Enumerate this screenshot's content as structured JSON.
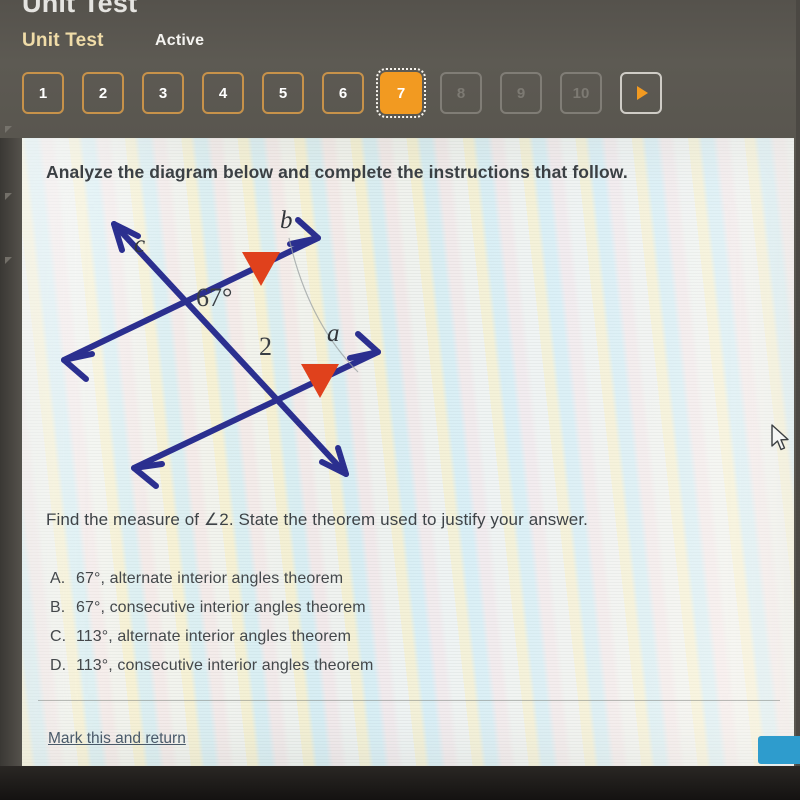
{
  "window": {
    "title_cut": "Unit Test",
    "heading": "Unit Test",
    "status": "Active",
    "header_bg": "#5a5750",
    "accent": "#f29a21"
  },
  "question_nav": {
    "buttons": [
      {
        "label": "1",
        "state": "available"
      },
      {
        "label": "2",
        "state": "available"
      },
      {
        "label": "3",
        "state": "available"
      },
      {
        "label": "4",
        "state": "available"
      },
      {
        "label": "5",
        "state": "available"
      },
      {
        "label": "6",
        "state": "available"
      },
      {
        "label": "7",
        "state": "active"
      },
      {
        "label": "8",
        "state": "disabled"
      },
      {
        "label": "9",
        "state": "disabled"
      },
      {
        "label": "10",
        "state": "disabled"
      }
    ],
    "next_label": "▶"
  },
  "content": {
    "prompt": "Analyze the diagram below and complete the instructions that follow.",
    "question_pre": "Find the measure of ",
    "question_angle": "∠2",
    "question_post": ". State the theorem used to justify your answer.",
    "choices": [
      {
        "letter": "A.",
        "text": "67°, alternate interior angles theorem"
      },
      {
        "letter": "B.",
        "text": "67°, consecutive interior angles theorem"
      },
      {
        "letter": "C.",
        "text": "113°, alternate interior angles theorem"
      },
      {
        "letter": "D.",
        "text": "113°, consecutive interior angles theorem"
      }
    ],
    "mark_link": "Mark this and return"
  },
  "diagram": {
    "line_b_label": "b",
    "line_a_label": "a",
    "line_c_label": "c",
    "angle_known": "67°",
    "angle_unknown": "2",
    "line_color": "#2b2f8f",
    "marker_color": "#e0411c"
  }
}
